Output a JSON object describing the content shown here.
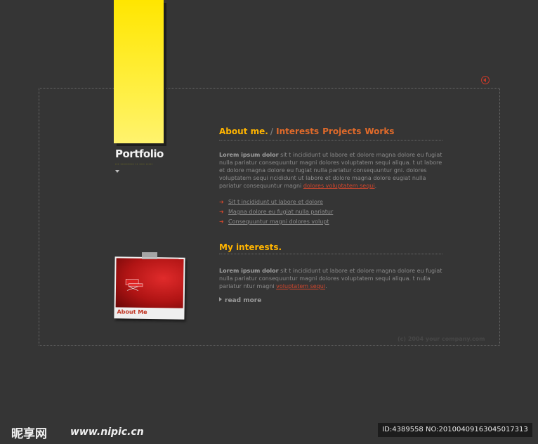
{
  "brand": {
    "title": "Portfolio",
    "subtitle": "--- ---------- -- ---- -----"
  },
  "nav": {
    "active": "About me.",
    "separator": "/",
    "tabs": [
      "Interests",
      "Projects",
      "Works"
    ]
  },
  "about": {
    "lead": "Lorem ipsum dolor",
    "text": " sit t incididunt ut labore et dolore magna dolore eu fugiat nulla pariatur consequuntur magni dolores voluptatem sequi aliqua. t ut labore et dolore magna dolore eu fugiat nulla pariatur consequuntur gni. dolores voluptatem sequi ncididunt ut labore et dolore magna dolore eugiat nulla pariatur consequuntur magni ",
    "link": "dolores voluptatem sequi",
    "end": "."
  },
  "links": [
    "Sit t incididunt ut labore et dolore",
    "Magna dolore eu fugiat nulla pariatur",
    "Consequuntur magni dolores volupt"
  ],
  "interests": {
    "heading": "My interests.",
    "lead": "Lorem ipsum dolor",
    "text": " sit t incididunt ut labore et dolore magna dolore eu fugiat nulla pariatur consequuntur magni dolores voluptatem sequi aliqua. t nulla pariatur ntur magni ",
    "link": "voluptatem sequi",
    "end": ".",
    "more": "read more"
  },
  "photo": {
    "caption": "About Me"
  },
  "copyright": "(c) 2004 your company.com",
  "watermark": {
    "logo": "昵享网",
    "url": "www.nipic.cn",
    "id": "ID:4389558 NO:20100409163045017313"
  },
  "colors": {
    "accent": "#ffb400",
    "link": "#d0462c",
    "banner": "#ffe600",
    "background": "#353535"
  },
  "icons": {
    "close": "circle-arrow-left-icon",
    "bullet": "arrow-right-icon"
  }
}
